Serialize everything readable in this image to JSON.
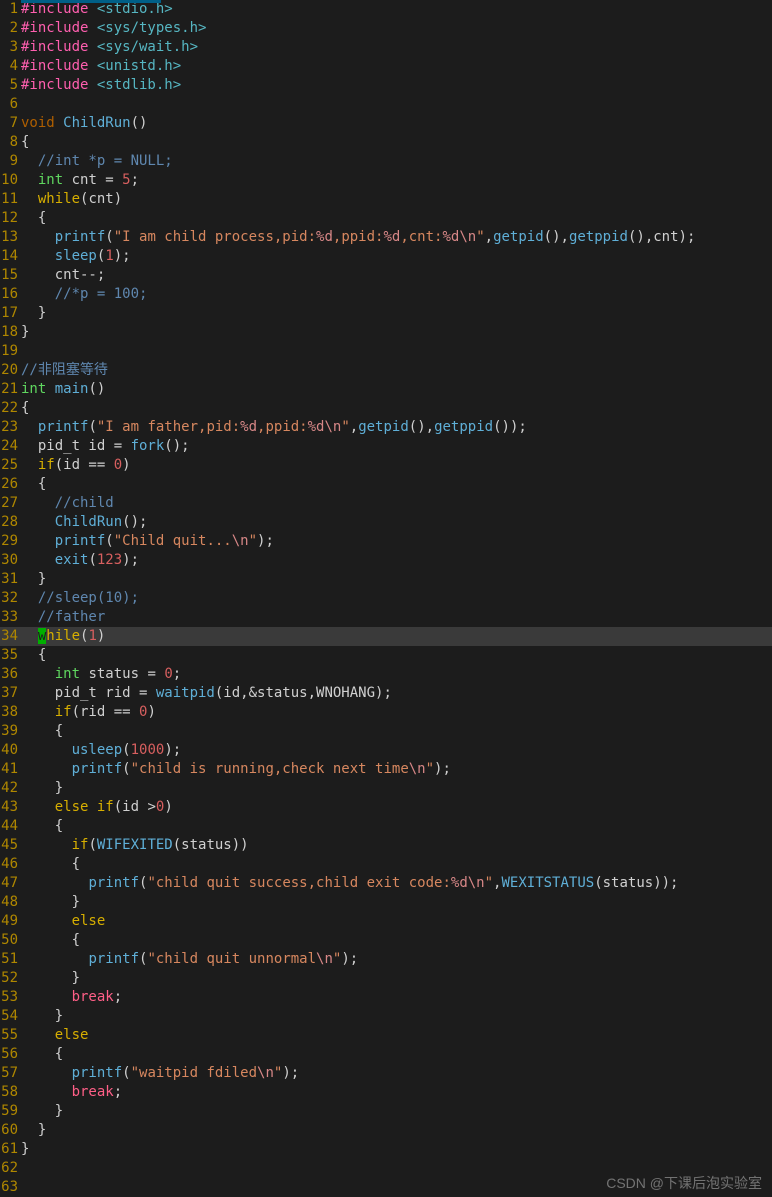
{
  "watermark": "CSDN @下课后泡实验室",
  "cursor_line": 34,
  "lines": [
    {
      "n": 1,
      "tokens": [
        [
          "#include ",
          "tk-include"
        ],
        [
          "<stdio.h>",
          "tk-header"
        ]
      ]
    },
    {
      "n": 2,
      "tokens": [
        [
          "#include ",
          "tk-include"
        ],
        [
          "<sys/types.h>",
          "tk-header"
        ]
      ]
    },
    {
      "n": 3,
      "tokens": [
        [
          "#include ",
          "tk-include"
        ],
        [
          "<sys/wait.h>",
          "tk-header"
        ]
      ]
    },
    {
      "n": 4,
      "tokens": [
        [
          "#include ",
          "tk-include"
        ],
        [
          "<unistd.h>",
          "tk-header"
        ]
      ]
    },
    {
      "n": 5,
      "tokens": [
        [
          "#include ",
          "tk-include"
        ],
        [
          "<stdlib.h>",
          "tk-header"
        ]
      ]
    },
    {
      "n": 6,
      "tokens": [
        [
          "",
          ""
        ]
      ]
    },
    {
      "n": 7,
      "tokens": [
        [
          "void",
          "tk-void"
        ],
        [
          " ",
          ""
        ],
        [
          "ChildRun",
          "tk-func-def"
        ],
        [
          "()",
          ""
        ]
      ]
    },
    {
      "n": 8,
      "tokens": [
        [
          "{",
          ""
        ]
      ]
    },
    {
      "n": 9,
      "tokens": [
        [
          "  ",
          ""
        ],
        [
          "//int *p = NULL;",
          "tk-comment"
        ]
      ]
    },
    {
      "n": 10,
      "tokens": [
        [
          "  ",
          ""
        ],
        [
          "int",
          "tk-type"
        ],
        [
          " cnt = ",
          ""
        ],
        [
          "5",
          "tk-num"
        ],
        [
          ";",
          ""
        ]
      ]
    },
    {
      "n": 11,
      "tokens": [
        [
          "  ",
          ""
        ],
        [
          "while",
          "tk-keyword"
        ],
        [
          "(cnt)",
          ""
        ]
      ]
    },
    {
      "n": 12,
      "tokens": [
        [
          "  {",
          ""
        ]
      ]
    },
    {
      "n": 13,
      "tokens": [
        [
          "    ",
          ""
        ],
        [
          "printf",
          "tk-func-call"
        ],
        [
          "(",
          ""
        ],
        [
          "\"I am child process,pid:",
          "tk-string"
        ],
        [
          "%d",
          "tk-fmt"
        ],
        [
          ",ppid:",
          "tk-string"
        ],
        [
          "%d",
          "tk-fmt"
        ],
        [
          ",cnt:",
          "tk-string"
        ],
        [
          "%d",
          "tk-fmt"
        ],
        [
          "\\n",
          "tk-escape"
        ],
        [
          "\"",
          "tk-string"
        ],
        [
          ",",
          ""
        ],
        [
          "getpid",
          "tk-func-call"
        ],
        [
          "(),",
          ""
        ],
        [
          "getppid",
          "tk-func-call"
        ],
        [
          "(),cnt);",
          ""
        ]
      ]
    },
    {
      "n": 14,
      "tokens": [
        [
          "    ",
          ""
        ],
        [
          "sleep",
          "tk-func-call"
        ],
        [
          "(",
          ""
        ],
        [
          "1",
          "tk-num"
        ],
        [
          ");",
          ""
        ]
      ]
    },
    {
      "n": 15,
      "tokens": [
        [
          "    cnt--;",
          ""
        ]
      ]
    },
    {
      "n": 16,
      "tokens": [
        [
          "    ",
          ""
        ],
        [
          "//*p = 100;",
          "tk-comment"
        ]
      ]
    },
    {
      "n": 17,
      "tokens": [
        [
          "  }",
          ""
        ]
      ]
    },
    {
      "n": 18,
      "tokens": [
        [
          "}",
          ""
        ]
      ]
    },
    {
      "n": 19,
      "tokens": [
        [
          "",
          ""
        ]
      ]
    },
    {
      "n": 20,
      "tokens": [
        [
          "//非阻塞等待",
          "tk-comment"
        ]
      ]
    },
    {
      "n": 21,
      "tokens": [
        [
          "int",
          "tk-type"
        ],
        [
          " ",
          ""
        ],
        [
          "main",
          "tk-func-def"
        ],
        [
          "()",
          ""
        ]
      ]
    },
    {
      "n": 22,
      "tokens": [
        [
          "{",
          ""
        ]
      ]
    },
    {
      "n": 23,
      "tokens": [
        [
          "  ",
          ""
        ],
        [
          "printf",
          "tk-func-call"
        ],
        [
          "(",
          ""
        ],
        [
          "\"I am father,pid:",
          "tk-string"
        ],
        [
          "%d",
          "tk-fmt"
        ],
        [
          ",ppid:",
          "tk-string"
        ],
        [
          "%d",
          "tk-fmt"
        ],
        [
          "\\n",
          "tk-escape"
        ],
        [
          "\"",
          "tk-string"
        ],
        [
          ",",
          ""
        ],
        [
          "getpid",
          "tk-func-call"
        ],
        [
          "(),",
          ""
        ],
        [
          "getppid",
          "tk-func-call"
        ],
        [
          "());",
          ""
        ]
      ]
    },
    {
      "n": 24,
      "tokens": [
        [
          "  pid_t id = ",
          ""
        ],
        [
          "fork",
          "tk-func-call"
        ],
        [
          "();",
          ""
        ]
      ]
    },
    {
      "n": 25,
      "tokens": [
        [
          "  ",
          ""
        ],
        [
          "if",
          "tk-keyword"
        ],
        [
          "(id == ",
          ""
        ],
        [
          "0",
          "tk-num"
        ],
        [
          ")",
          ""
        ]
      ]
    },
    {
      "n": 26,
      "tokens": [
        [
          "  {",
          ""
        ]
      ]
    },
    {
      "n": 27,
      "tokens": [
        [
          "    ",
          ""
        ],
        [
          "//child",
          "tk-comment"
        ]
      ]
    },
    {
      "n": 28,
      "tokens": [
        [
          "    ",
          ""
        ],
        [
          "ChildRun",
          "tk-func-call"
        ],
        [
          "();",
          ""
        ]
      ]
    },
    {
      "n": 29,
      "tokens": [
        [
          "    ",
          ""
        ],
        [
          "printf",
          "tk-func-call"
        ],
        [
          "(",
          ""
        ],
        [
          "\"Child quit...",
          "tk-string"
        ],
        [
          "\\n",
          "tk-escape"
        ],
        [
          "\"",
          "tk-string"
        ],
        [
          ");",
          ""
        ]
      ]
    },
    {
      "n": 30,
      "tokens": [
        [
          "    ",
          ""
        ],
        [
          "exit",
          "tk-func-call"
        ],
        [
          "(",
          ""
        ],
        [
          "123",
          "tk-num"
        ],
        [
          ");",
          ""
        ]
      ]
    },
    {
      "n": 31,
      "tokens": [
        [
          "  }",
          ""
        ]
      ]
    },
    {
      "n": 32,
      "tokens": [
        [
          "  ",
          ""
        ],
        [
          "//sleep(10);",
          "tk-comment"
        ]
      ]
    },
    {
      "n": 33,
      "tokens": [
        [
          "  ",
          ""
        ],
        [
          "//father",
          "tk-comment"
        ]
      ]
    },
    {
      "n": 34,
      "current": true,
      "tokens": [
        [
          "  ",
          ""
        ],
        [
          "w",
          "cursor"
        ],
        [
          "hile",
          "tk-keyword"
        ],
        [
          "(",
          ""
        ],
        [
          "1",
          "tk-num"
        ],
        [
          ")",
          ""
        ]
      ]
    },
    {
      "n": 35,
      "tokens": [
        [
          "  {",
          ""
        ]
      ]
    },
    {
      "n": 36,
      "tokens": [
        [
          "    ",
          ""
        ],
        [
          "int",
          "tk-type"
        ],
        [
          " status = ",
          ""
        ],
        [
          "0",
          "tk-num"
        ],
        [
          ";",
          ""
        ]
      ]
    },
    {
      "n": 37,
      "tokens": [
        [
          "    pid_t rid = ",
          ""
        ],
        [
          "waitpid",
          "tk-func-call"
        ],
        [
          "(id,&status,WNOHANG);",
          ""
        ]
      ]
    },
    {
      "n": 38,
      "tokens": [
        [
          "    ",
          ""
        ],
        [
          "if",
          "tk-keyword"
        ],
        [
          "(rid == ",
          ""
        ],
        [
          "0",
          "tk-num"
        ],
        [
          ")",
          ""
        ]
      ]
    },
    {
      "n": 39,
      "tokens": [
        [
          "    {",
          ""
        ]
      ]
    },
    {
      "n": 40,
      "tokens": [
        [
          "      ",
          ""
        ],
        [
          "usleep",
          "tk-func-call"
        ],
        [
          "(",
          ""
        ],
        [
          "1000",
          "tk-num"
        ],
        [
          ");",
          ""
        ]
      ]
    },
    {
      "n": 41,
      "tokens": [
        [
          "      ",
          ""
        ],
        [
          "printf",
          "tk-func-call"
        ],
        [
          "(",
          ""
        ],
        [
          "\"child is running,check next time",
          "tk-string"
        ],
        [
          "\\n",
          "tk-escape"
        ],
        [
          "\"",
          "tk-string"
        ],
        [
          ");",
          ""
        ]
      ]
    },
    {
      "n": 42,
      "tokens": [
        [
          "    }",
          ""
        ]
      ]
    },
    {
      "n": 43,
      "tokens": [
        [
          "    ",
          ""
        ],
        [
          "else",
          "tk-keyword"
        ],
        [
          " ",
          ""
        ],
        [
          "if",
          "tk-keyword"
        ],
        [
          "(id >",
          ""
        ],
        [
          "0",
          "tk-num"
        ],
        [
          ")",
          ""
        ]
      ]
    },
    {
      "n": 44,
      "tokens": [
        [
          "    {",
          ""
        ]
      ]
    },
    {
      "n": 45,
      "tokens": [
        [
          "      ",
          ""
        ],
        [
          "if",
          "tk-keyword"
        ],
        [
          "(",
          ""
        ],
        [
          "WIFEXITED",
          "tk-func-call"
        ],
        [
          "(status))",
          ""
        ]
      ]
    },
    {
      "n": 46,
      "tokens": [
        [
          "      {",
          ""
        ]
      ]
    },
    {
      "n": 47,
      "tokens": [
        [
          "        ",
          ""
        ],
        [
          "printf",
          "tk-func-call"
        ],
        [
          "(",
          ""
        ],
        [
          "\"child quit success,child exit code:",
          "tk-string"
        ],
        [
          "%d",
          "tk-fmt"
        ],
        [
          "\\n",
          "tk-escape"
        ],
        [
          "\"",
          "tk-string"
        ],
        [
          ",",
          ""
        ],
        [
          "WEXITSTATUS",
          "tk-func-call"
        ],
        [
          "(status));",
          ""
        ]
      ]
    },
    {
      "n": 48,
      "tokens": [
        [
          "      }",
          ""
        ]
      ]
    },
    {
      "n": 49,
      "tokens": [
        [
          "      ",
          ""
        ],
        [
          "else",
          "tk-keyword"
        ]
      ]
    },
    {
      "n": 50,
      "tokens": [
        [
          "      {",
          ""
        ]
      ]
    },
    {
      "n": 51,
      "tokens": [
        [
          "        ",
          ""
        ],
        [
          "printf",
          "tk-func-call"
        ],
        [
          "(",
          ""
        ],
        [
          "\"child quit unnormal",
          "tk-string"
        ],
        [
          "\\n",
          "tk-escape"
        ],
        [
          "\"",
          "tk-string"
        ],
        [
          ");",
          ""
        ]
      ]
    },
    {
      "n": 52,
      "tokens": [
        [
          "      }",
          ""
        ]
      ]
    },
    {
      "n": 53,
      "tokens": [
        [
          "      ",
          ""
        ],
        [
          "break",
          "tk-keyword2"
        ],
        [
          ";",
          ""
        ]
      ]
    },
    {
      "n": 54,
      "tokens": [
        [
          "    }",
          ""
        ]
      ]
    },
    {
      "n": 55,
      "tokens": [
        [
          "    ",
          ""
        ],
        [
          "else",
          "tk-keyword"
        ]
      ]
    },
    {
      "n": 56,
      "tokens": [
        [
          "    {",
          ""
        ]
      ]
    },
    {
      "n": 57,
      "tokens": [
        [
          "      ",
          ""
        ],
        [
          "printf",
          "tk-func-call"
        ],
        [
          "(",
          ""
        ],
        [
          "\"waitpid fdiled",
          "tk-string"
        ],
        [
          "\\n",
          "tk-escape"
        ],
        [
          "\"",
          "tk-string"
        ],
        [
          ");",
          ""
        ]
      ]
    },
    {
      "n": 58,
      "tokens": [
        [
          "      ",
          ""
        ],
        [
          "break",
          "tk-keyword2"
        ],
        [
          ";",
          ""
        ]
      ]
    },
    {
      "n": 59,
      "tokens": [
        [
          "    }",
          ""
        ]
      ]
    },
    {
      "n": 60,
      "tokens": [
        [
          "  }",
          ""
        ]
      ]
    },
    {
      "n": 61,
      "tokens": [
        [
          "}",
          ""
        ]
      ]
    },
    {
      "n": 62,
      "tokens": [
        [
          "",
          ""
        ]
      ]
    },
    {
      "n": 63,
      "tokens": [
        [
          "",
          ""
        ]
      ]
    }
  ]
}
